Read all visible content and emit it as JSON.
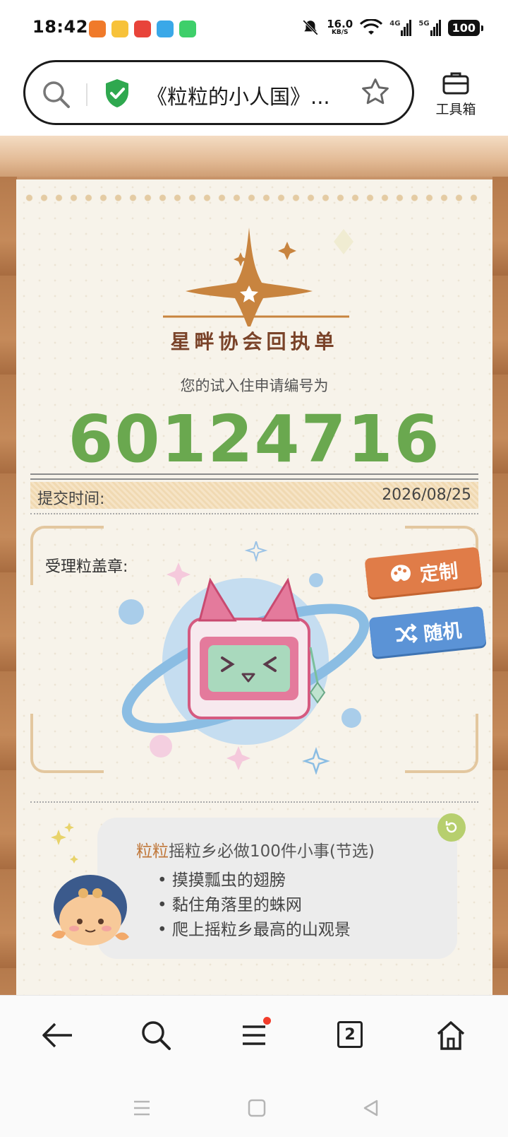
{
  "status_bar": {
    "time": "18:42",
    "net_speed_value": "16.0",
    "net_speed_unit": "KB/S",
    "signal_4g": "4G",
    "signal_5g": "5G",
    "battery": "100",
    "notification_icons": [
      "orange-app-icon",
      "weibo-icon",
      "red-app-icon",
      "telegram-icon",
      "green-message-icon"
    ]
  },
  "address_bar": {
    "title": "《粒粒的小人国》...",
    "toolbox_label": "工具箱"
  },
  "page": {
    "logo_text": "星畔协会回执单",
    "apply_label": "您的试入住申请编号为",
    "apply_number": "60124716",
    "submit_label": "提交时间:",
    "submit_date": "2026/08/25",
    "stamp_label": "受理粒盖章:",
    "custom_button": "定制",
    "random_button": "随机",
    "todo": {
      "title_highlight": "粒粒",
      "title_rest": "摇粒乡必做100件小事(节选)",
      "items": [
        "摸摸瓢虫的翅膀",
        "黏住角落里的蛛网",
        "爬上摇粒乡最高的山观景"
      ]
    }
  },
  "bottom_nav": {
    "tab_count": "2",
    "buttons": [
      "back-arrow-icon",
      "search-icon",
      "menu-icon",
      "tabs-icon",
      "home-icon"
    ]
  },
  "colors": {
    "apply_number": "#6aa84f",
    "custom_button": "#e07c48",
    "random_button": "#5b93d6",
    "logo_brown": "#c8843f"
  }
}
